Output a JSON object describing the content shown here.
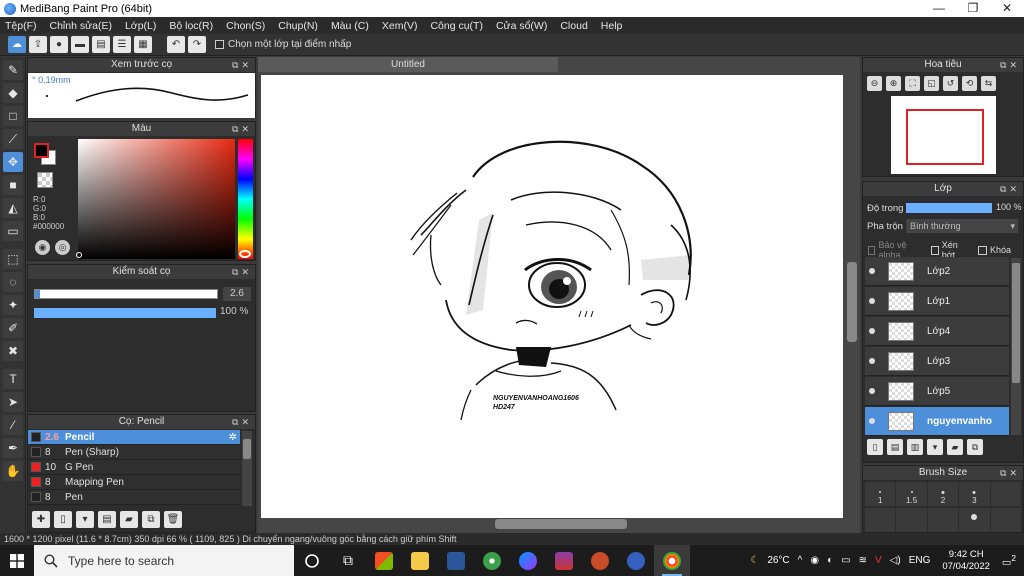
{
  "window": {
    "title": "MediBang Paint Pro (64bit)",
    "minimize": "—",
    "maximize": "❐",
    "close": "✕"
  },
  "menu": [
    "Tệp(F)",
    "Chỉnh sửa(E)",
    "Lớp(L)",
    "Bộ lọc(R)",
    "Chọn(S)",
    "Chụp(N)",
    "Màu (C)",
    "Xem(V)",
    "Công cụ(T)",
    "Cửa sổ(W)",
    "Cloud",
    "Help"
  ],
  "toolbar": {
    "select_layer_on_click_label": "Chọn một lớp tại điểm nhấp"
  },
  "brush_preview": {
    "title": "Xem trước cọ",
    "size_label": "° 0.19mm"
  },
  "color_panel": {
    "title": "Màu",
    "r_label": "R:0",
    "g_label": "G:0",
    "b_label": "B:0",
    "hex_label": "#000000",
    "foreground_color": "#000000",
    "background_color": "#ffffff"
  },
  "brush_control": {
    "title": "Kiểm soát cọ",
    "size_value": "2.6",
    "opacity_value": "100 %",
    "opacity_fraction": 1.0
  },
  "brush_list": {
    "title": "Cọ: Pencil",
    "items": [
      {
        "size": "2.6",
        "name": "Pencil",
        "swatch": "dark",
        "selected": true
      },
      {
        "size": "8",
        "name": "Pen (Sharp)",
        "swatch": "dark",
        "selected": false
      },
      {
        "size": "10",
        "name": "G Pen",
        "swatch": "red",
        "selected": false
      },
      {
        "size": "8",
        "name": "Mapping Pen",
        "swatch": "red",
        "selected": false
      },
      {
        "size": "8",
        "name": "Pen",
        "swatch": "dark",
        "selected": false
      }
    ]
  },
  "canvas": {
    "tab_title": "Untitled",
    "watermark_line1": "NGUYENVANHOANG1606",
    "watermark_line2": "HD247"
  },
  "navigator": {
    "title": "Hoa tiêu"
  },
  "layers_panel": {
    "title": "Lớp",
    "opacity_label": "Độ trong",
    "opacity_value": "100 %",
    "opacity_fraction": 1.0,
    "blend_label": "Pha trộn",
    "blend_value": "Bình thường",
    "protect_alpha_label": "Bảo vệ alpha",
    "clipping_label": "Xén bớt",
    "lock_label": "Khóa",
    "layers": [
      {
        "name": "Lớp2",
        "selected": false
      },
      {
        "name": "Lớp1",
        "selected": false
      },
      {
        "name": "Lớp4",
        "selected": false
      },
      {
        "name": "Lớp3",
        "selected": false
      },
      {
        "name": "Lớp5",
        "selected": false
      },
      {
        "name": "nguyenvanho",
        "selected": true
      }
    ]
  },
  "brush_size_panel": {
    "title": "Brush Size",
    "sizes": [
      "1",
      "1.5",
      "2",
      "3",
      "",
      "",
      "",
      "",
      "",
      ""
    ]
  },
  "status_bar": {
    "text": "1600 * 1200 pixel   (11.6 * 8.7cm)   350 dpi   66 %   ( 1109, 825 )   Di chuyển ngang/vuông góc bằng cách giữ phím Shift"
  },
  "taskbar": {
    "search_placeholder": "Type here to search",
    "weather": "26°C",
    "language": "ENG",
    "time": "9:42 CH",
    "date": "07/04/2022",
    "notification_count": "2"
  },
  "colors": {
    "accent": "#4d8fd8",
    "panel_bg": "#2d2d2d",
    "canvas_bg": "#ffffff"
  }
}
